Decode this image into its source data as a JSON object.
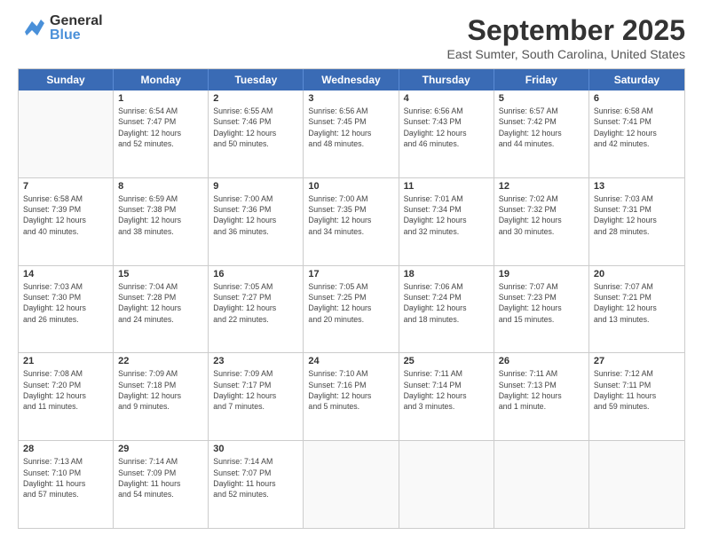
{
  "logo": {
    "general": "General",
    "blue": "Blue"
  },
  "title": "September 2025",
  "location": "East Sumter, South Carolina, United States",
  "days": [
    "Sunday",
    "Monday",
    "Tuesday",
    "Wednesday",
    "Thursday",
    "Friday",
    "Saturday"
  ],
  "weeks": [
    [
      {
        "date": "",
        "info": ""
      },
      {
        "date": "1",
        "info": "Sunrise: 6:54 AM\nSunset: 7:47 PM\nDaylight: 12 hours\nand 52 minutes."
      },
      {
        "date": "2",
        "info": "Sunrise: 6:55 AM\nSunset: 7:46 PM\nDaylight: 12 hours\nand 50 minutes."
      },
      {
        "date": "3",
        "info": "Sunrise: 6:56 AM\nSunset: 7:45 PM\nDaylight: 12 hours\nand 48 minutes."
      },
      {
        "date": "4",
        "info": "Sunrise: 6:56 AM\nSunset: 7:43 PM\nDaylight: 12 hours\nand 46 minutes."
      },
      {
        "date": "5",
        "info": "Sunrise: 6:57 AM\nSunset: 7:42 PM\nDaylight: 12 hours\nand 44 minutes."
      },
      {
        "date": "6",
        "info": "Sunrise: 6:58 AM\nSunset: 7:41 PM\nDaylight: 12 hours\nand 42 minutes."
      }
    ],
    [
      {
        "date": "7",
        "info": "Sunrise: 6:58 AM\nSunset: 7:39 PM\nDaylight: 12 hours\nand 40 minutes."
      },
      {
        "date": "8",
        "info": "Sunrise: 6:59 AM\nSunset: 7:38 PM\nDaylight: 12 hours\nand 38 minutes."
      },
      {
        "date": "9",
        "info": "Sunrise: 7:00 AM\nSunset: 7:36 PM\nDaylight: 12 hours\nand 36 minutes."
      },
      {
        "date": "10",
        "info": "Sunrise: 7:00 AM\nSunset: 7:35 PM\nDaylight: 12 hours\nand 34 minutes."
      },
      {
        "date": "11",
        "info": "Sunrise: 7:01 AM\nSunset: 7:34 PM\nDaylight: 12 hours\nand 32 minutes."
      },
      {
        "date": "12",
        "info": "Sunrise: 7:02 AM\nSunset: 7:32 PM\nDaylight: 12 hours\nand 30 minutes."
      },
      {
        "date": "13",
        "info": "Sunrise: 7:03 AM\nSunset: 7:31 PM\nDaylight: 12 hours\nand 28 minutes."
      }
    ],
    [
      {
        "date": "14",
        "info": "Sunrise: 7:03 AM\nSunset: 7:30 PM\nDaylight: 12 hours\nand 26 minutes."
      },
      {
        "date": "15",
        "info": "Sunrise: 7:04 AM\nSunset: 7:28 PM\nDaylight: 12 hours\nand 24 minutes."
      },
      {
        "date": "16",
        "info": "Sunrise: 7:05 AM\nSunset: 7:27 PM\nDaylight: 12 hours\nand 22 minutes."
      },
      {
        "date": "17",
        "info": "Sunrise: 7:05 AM\nSunset: 7:25 PM\nDaylight: 12 hours\nand 20 minutes."
      },
      {
        "date": "18",
        "info": "Sunrise: 7:06 AM\nSunset: 7:24 PM\nDaylight: 12 hours\nand 18 minutes."
      },
      {
        "date": "19",
        "info": "Sunrise: 7:07 AM\nSunset: 7:23 PM\nDaylight: 12 hours\nand 15 minutes."
      },
      {
        "date": "20",
        "info": "Sunrise: 7:07 AM\nSunset: 7:21 PM\nDaylight: 12 hours\nand 13 minutes."
      }
    ],
    [
      {
        "date": "21",
        "info": "Sunrise: 7:08 AM\nSunset: 7:20 PM\nDaylight: 12 hours\nand 11 minutes."
      },
      {
        "date": "22",
        "info": "Sunrise: 7:09 AM\nSunset: 7:18 PM\nDaylight: 12 hours\nand 9 minutes."
      },
      {
        "date": "23",
        "info": "Sunrise: 7:09 AM\nSunset: 7:17 PM\nDaylight: 12 hours\nand 7 minutes."
      },
      {
        "date": "24",
        "info": "Sunrise: 7:10 AM\nSunset: 7:16 PM\nDaylight: 12 hours\nand 5 minutes."
      },
      {
        "date": "25",
        "info": "Sunrise: 7:11 AM\nSunset: 7:14 PM\nDaylight: 12 hours\nand 3 minutes."
      },
      {
        "date": "26",
        "info": "Sunrise: 7:11 AM\nSunset: 7:13 PM\nDaylight: 12 hours\nand 1 minute."
      },
      {
        "date": "27",
        "info": "Sunrise: 7:12 AM\nSunset: 7:11 PM\nDaylight: 11 hours\nand 59 minutes."
      }
    ],
    [
      {
        "date": "28",
        "info": "Sunrise: 7:13 AM\nSunset: 7:10 PM\nDaylight: 11 hours\nand 57 minutes."
      },
      {
        "date": "29",
        "info": "Sunrise: 7:14 AM\nSunset: 7:09 PM\nDaylight: 11 hours\nand 54 minutes."
      },
      {
        "date": "30",
        "info": "Sunrise: 7:14 AM\nSunset: 7:07 PM\nDaylight: 11 hours\nand 52 minutes."
      },
      {
        "date": "",
        "info": ""
      },
      {
        "date": "",
        "info": ""
      },
      {
        "date": "",
        "info": ""
      },
      {
        "date": "",
        "info": ""
      }
    ]
  ]
}
